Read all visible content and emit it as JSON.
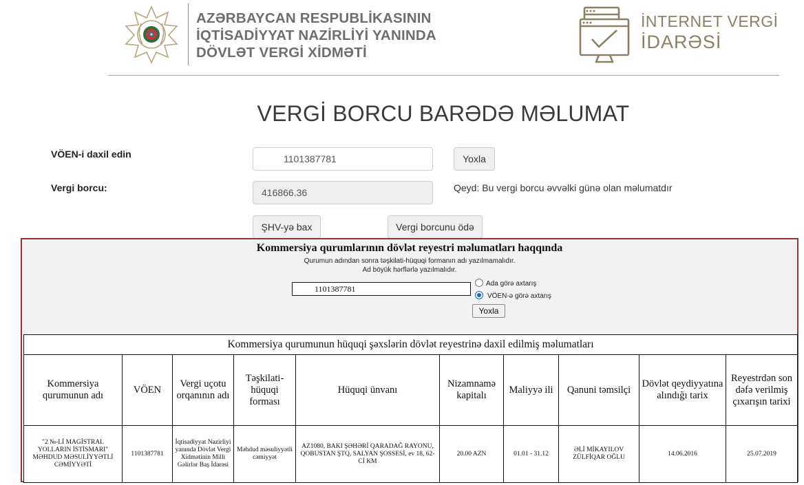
{
  "header": {
    "org_line1": "AZƏRBAYCAN RESPUBLİKASININ",
    "org_line2": "İQTİSADİYYAT NAZİRLİYİ YANINDA",
    "org_line3": "DÖVLƏT VERGİ XİDMƏTİ",
    "brand_line1": "İNTERNET VERGİ",
    "brand_line2": "İDARƏSİ",
    "logo_left_icon": "state-emblem-icon",
    "logo_right_icon": "monitor-checkmark-icon",
    "accent_color": "#8d7f63"
  },
  "page_title": "VERGİ BORCU BARƏDƏ MƏLUMAT",
  "form": {
    "voen_label": "VÖEN-i daxil edin",
    "voen_value": "1101387781",
    "check_button": "Yoxla",
    "debt_label": "Vergi borcu:",
    "debt_value": "416866.36",
    "note": "Qeyd: Bu vergi borcu əvvəlki günə olan məlumatdır",
    "shv_button": "ŞHV-yə bax",
    "pay_button": "Vergi borcunu ödə"
  },
  "registry": {
    "title": "Kommersiya qurumlarının dövlət reyestri məlumatları haqqında",
    "note1": "Qurumun adından sonra təşkilati-hüquqi formanın adı yazılmamalıdır.",
    "note2": "Ad böyük hərflərlə yazılmalıdır.",
    "search_value": "1101387781",
    "radio_by_name": "Ada görə axtarış",
    "radio_by_voen": "VÖEN-ə görə axtarış",
    "selected_radio": "VÖEN-ə görə axtarış",
    "search_button": "Yoxla",
    "frame_color": "#943634"
  },
  "table": {
    "caption": "Kommersiya qurumunun hüquqi şəxslərin dövlət reyestrinə daxil edilmiş məlumatları",
    "headers": [
      "Kommersiya qurumunun adı",
      "VÖEN",
      "Vergi uçotu orqanının adı",
      "Təşkilati-hüquqi forması",
      "Hüquqi ünvanı",
      "Nizamnamə kapitalı",
      "Maliyyə ili",
      "Qanuni təmsilçi",
      "Dövlət qeydiyyatına alındığı tarix",
      "Reyestrdən son dəfə verilmiş çıxarışın tarixi"
    ],
    "row": [
      "\"2 №-Lİ MAGİSTRAL YOLLARIN İSTİSMARI\" MƏHDUD MƏSULİYYƏTLİ CƏMİYYƏTİ",
      "1101387781",
      "İqtisadiyyat Nazirliyi yanında Dövlət Vergi Xidmətinin Milli Gəlirlər Baş İdarəsi",
      "Məhdud məsuliyyətli cəmiyyət",
      "AZ1080, BAKI ŞƏHƏRİ QARADAĞ RAYONU, QOBUSTAN ŞTQ, SALYAN ŞOSSESİ, ev 18, 62-Cİ KM",
      "20.00 AZN",
      "01.01 - 31.12",
      "ƏLİ MİKAYILOV ZÜLFİQAR OĞLU",
      "14.06.2016",
      "25.07.2019"
    ]
  }
}
